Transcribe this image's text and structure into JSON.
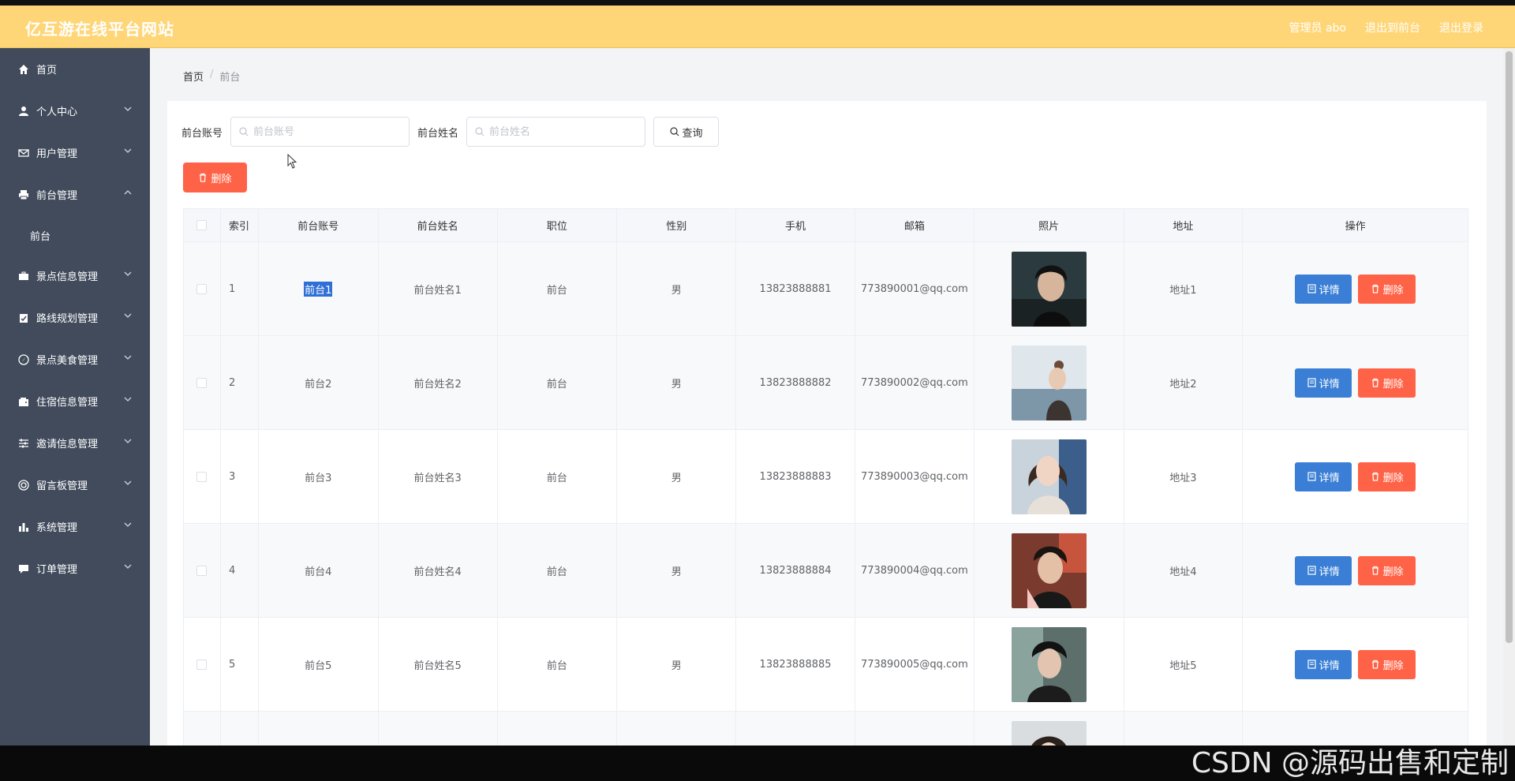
{
  "header": {
    "brand": "亿互游在线平台网站",
    "admin": "管理员 abo",
    "to_front": "退出到前台",
    "logout": "退出登录"
  },
  "sidebar": {
    "items": [
      {
        "label": "首页",
        "icon": "home-icon",
        "expandable": false
      },
      {
        "label": "个人中心",
        "icon": "user-icon",
        "expandable": true
      },
      {
        "label": "用户管理",
        "icon": "mail-icon",
        "expandable": true
      },
      {
        "label": "前台管理",
        "icon": "printer-icon",
        "expandable": true,
        "open": true,
        "children": [
          "前台"
        ]
      },
      {
        "label": "景点信息管理",
        "icon": "briefcase-icon",
        "expandable": true
      },
      {
        "label": "路线规划管理",
        "icon": "clipboard-icon",
        "expandable": true
      },
      {
        "label": "景点美食管理",
        "icon": "compass-icon",
        "expandable": true
      },
      {
        "label": "住宿信息管理",
        "icon": "wallet-icon",
        "expandable": true
      },
      {
        "label": "邀请信息管理",
        "icon": "sliders-icon",
        "expandable": true
      },
      {
        "label": "留言板管理",
        "icon": "circle-icon",
        "expandable": true
      },
      {
        "label": "系统管理",
        "icon": "bar-chart-icon",
        "expandable": true
      },
      {
        "label": "订单管理",
        "icon": "message-icon",
        "expandable": true
      }
    ]
  },
  "breadcrumb": {
    "home": "首页",
    "sep": "/",
    "current": "前台"
  },
  "search": {
    "label1": "前台账号",
    "placeholder1": "前台账号",
    "label2": "前台姓名",
    "placeholder2": "前台姓名",
    "query_label": "查询"
  },
  "delete_label": "删除",
  "table": {
    "headers": [
      "索引",
      "前台账号",
      "前台姓名",
      "职位",
      "性别",
      "手机",
      "邮箱",
      "照片",
      "地址",
      "操作"
    ],
    "rows": [
      {
        "index": "1",
        "account": "前台1",
        "name": "前台姓名1",
        "position": "前台",
        "gender": "男",
        "phone": "13823888881",
        "email": "773890001@qq.com",
        "address": "地址1"
      },
      {
        "index": "2",
        "account": "前台2",
        "name": "前台姓名2",
        "position": "前台",
        "gender": "男",
        "phone": "13823888882",
        "email": "773890002@qq.com",
        "address": "地址2"
      },
      {
        "index": "3",
        "account": "前台3",
        "name": "前台姓名3",
        "position": "前台",
        "gender": "男",
        "phone": "13823888883",
        "email": "773890003@qq.com",
        "address": "地址3"
      },
      {
        "index": "4",
        "account": "前台4",
        "name": "前台姓名4",
        "position": "前台",
        "gender": "男",
        "phone": "13823888884",
        "email": "773890004@qq.com",
        "address": "地址4"
      },
      {
        "index": "5",
        "account": "前台5",
        "name": "前台姓名5",
        "position": "前台",
        "gender": "男",
        "phone": "13823888885",
        "email": "773890005@qq.com",
        "address": "地址5"
      }
    ],
    "detail_label": "详情",
    "delete_label": "删除"
  },
  "watermark": "CSDN @源码出售和定制",
  "colors": {
    "header": "#FFD677",
    "sidebar": "#414b5c",
    "primary": "#3a7fd5",
    "danger": "#ff6347"
  }
}
